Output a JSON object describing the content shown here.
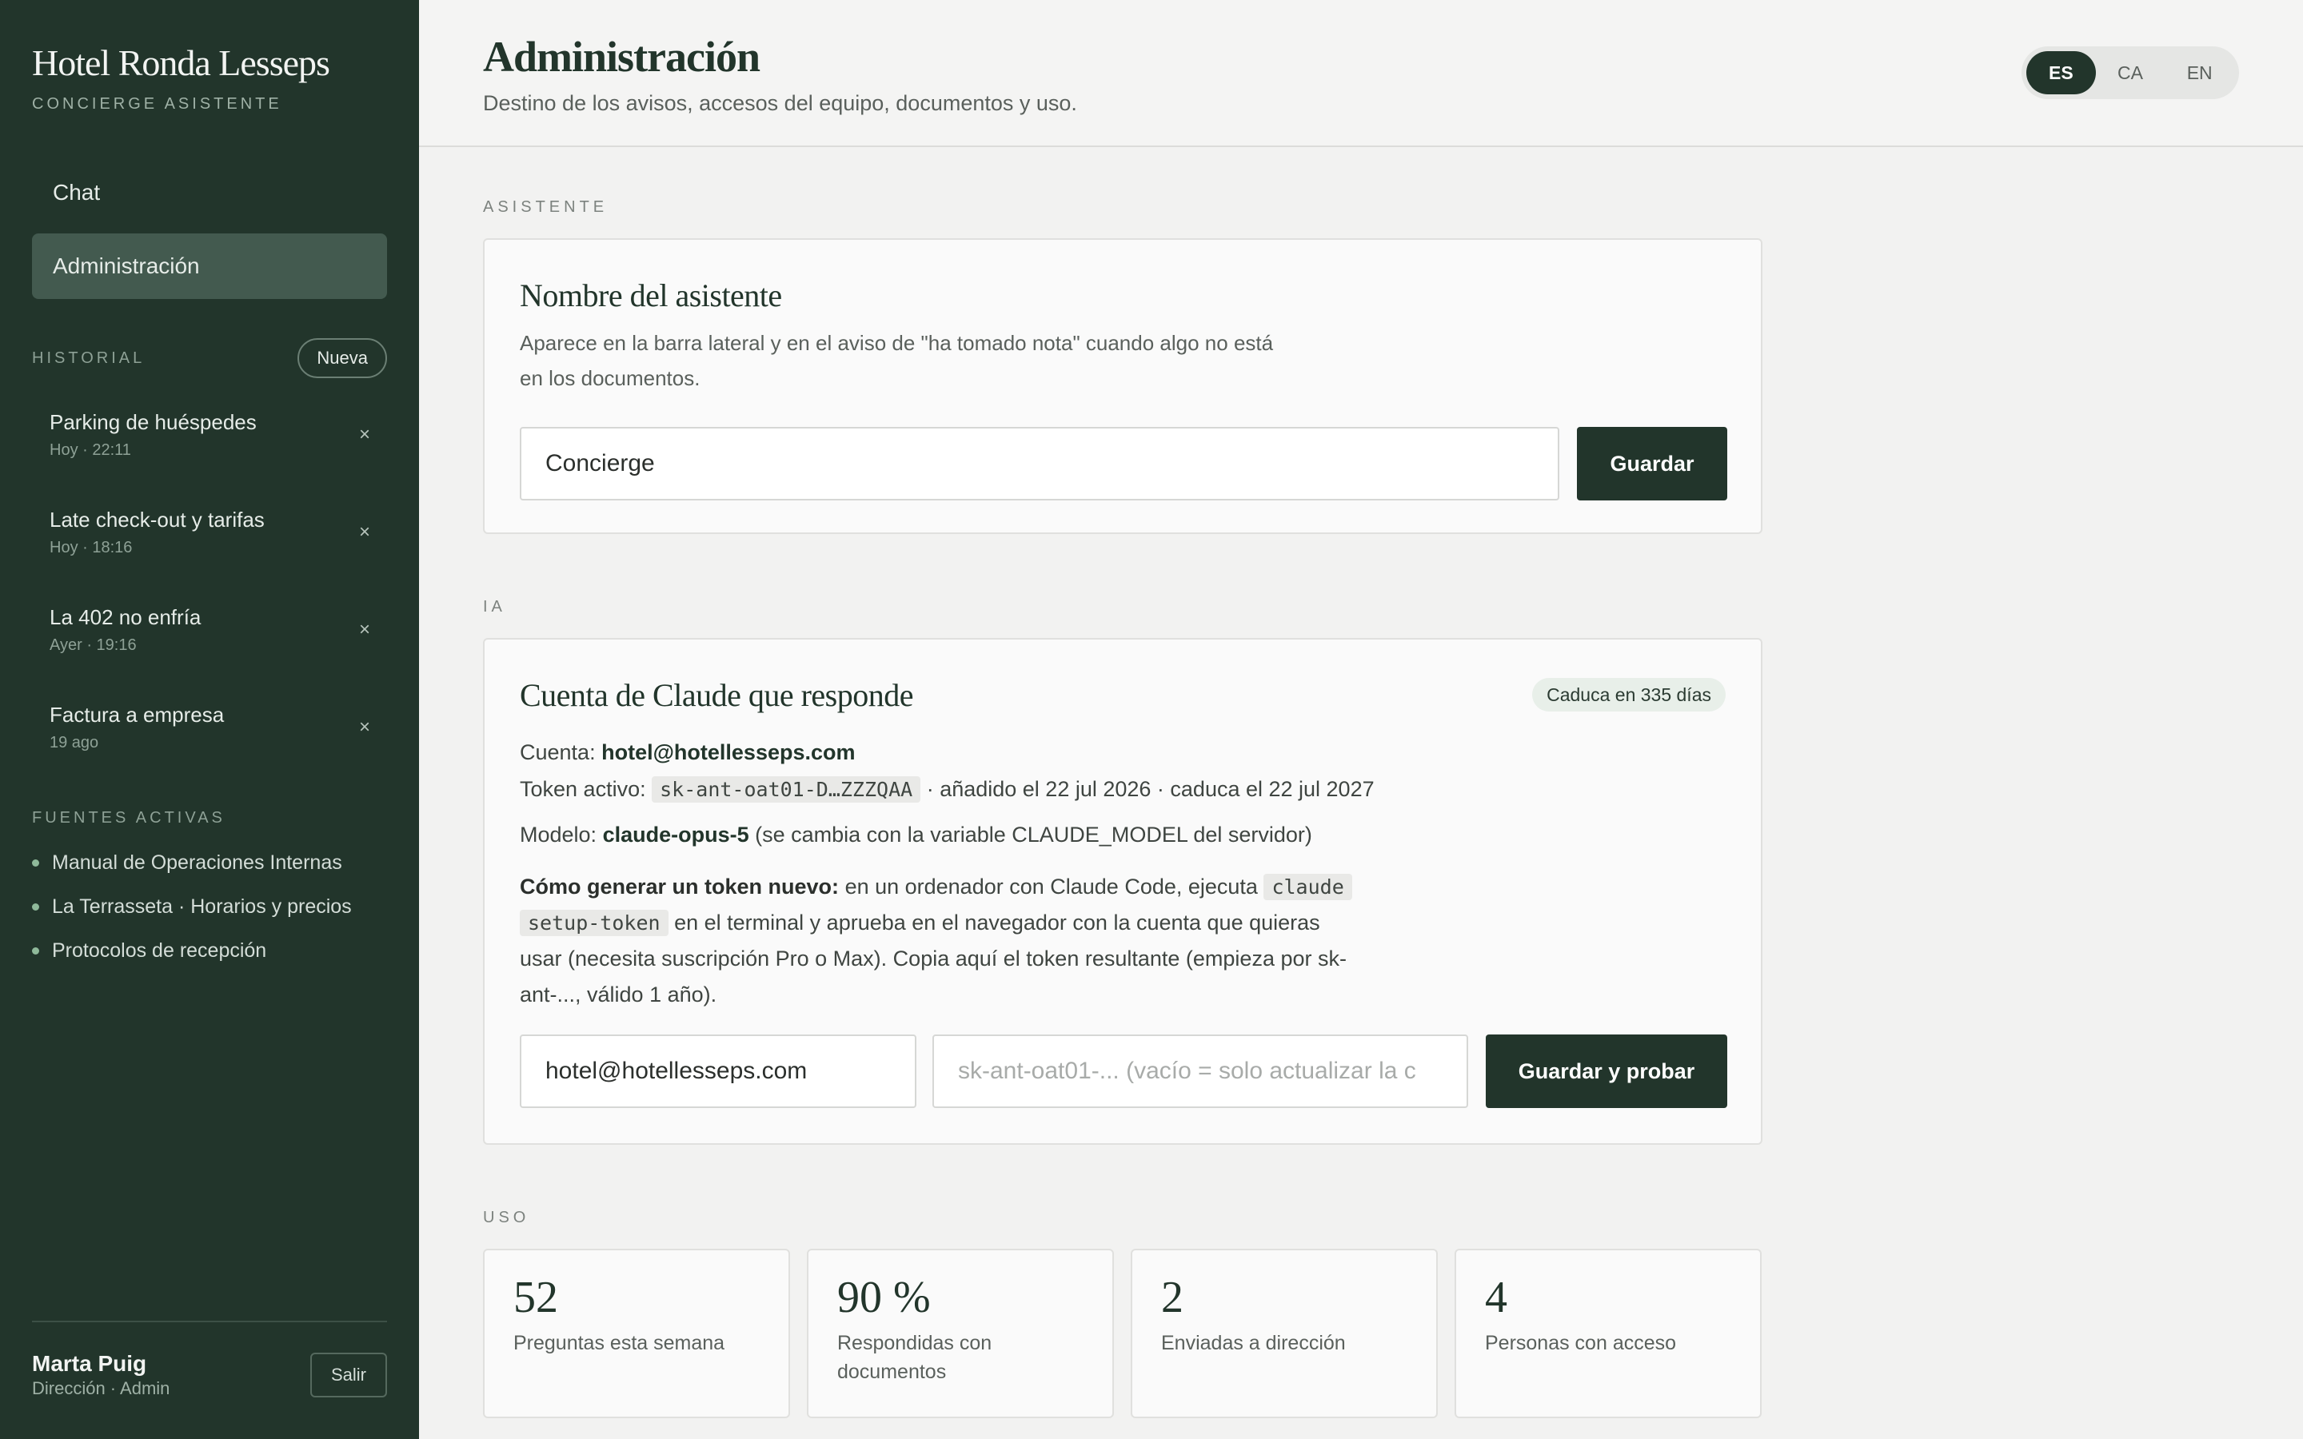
{
  "sidebar": {
    "brand_title": "Hotel Ronda Lesseps",
    "brand_subtitle": "CONCIERGE ASISTENTE",
    "nav": [
      {
        "label": "Chat",
        "active": false
      },
      {
        "label": "Administración",
        "active": true
      }
    ],
    "history_label": "HISTORIAL",
    "new_button": "Nueva",
    "history": [
      {
        "title": "Parking de huéspedes",
        "time": "Hoy · 22:11"
      },
      {
        "title": "Late check-out y tarifas",
        "time": "Hoy · 18:16"
      },
      {
        "title": "La 402 no enfría",
        "time": "Ayer · 19:16"
      },
      {
        "title": "Factura a empresa",
        "time": "19 ago"
      }
    ],
    "close_glyph": "×",
    "sources_label": "FUENTES ACTIVAS",
    "sources": [
      "Manual de Operaciones Internas",
      "La Terrasseta · Horarios y precios",
      "Protocolos de recepción"
    ],
    "user": {
      "name": "Marta Puig",
      "role": "Dirección · Admin",
      "logout": "Salir"
    }
  },
  "header": {
    "title": "Administración",
    "subtitle": "Destino de los avisos, accesos del equipo, documentos y uso.",
    "languages": [
      {
        "code": "ES",
        "active": true
      },
      {
        "code": "CA",
        "active": false
      },
      {
        "code": "EN",
        "active": false
      }
    ]
  },
  "assistant": {
    "section_label": "ASISTENTE",
    "title": "Nombre del asistente",
    "desc_line1": "Aparece en la barra lateral y en el aviso de \"ha tomado nota\" cuando algo no está",
    "desc_line2": "en los documentos.",
    "name_value": "Concierge",
    "save": "Guardar"
  },
  "ai": {
    "section_label": "IA",
    "title": "Cuenta de Claude que responde",
    "badge": "Caduca en 335 días",
    "account_label": "Cuenta:",
    "account_value": "hotel@hotellesseps.com",
    "token_label": "Token activo:",
    "token_value": "sk-ant-oat01-D…ZZZQAA",
    "token_meta": "· añadido el 22 jul 2026 · caduca el 22 jul 2027",
    "model_label": "Modelo:",
    "model_value": "claude-opus-5",
    "model_note": "(se cambia con la variable CLAUDE_MODEL del servidor)",
    "help_bold": "Cómo generar un token nuevo:",
    "help_pre": "en un ordenador con Claude Code, ejecuta",
    "help_code_1": "claude",
    "help_code_2": "setup-token",
    "help_mid": "en el terminal y aprueba en el navegador con la cuenta que quieras",
    "help_line3": "usar (necesita suscripción Pro o Max). Copia aquí el token resultante (empieza por sk-",
    "help_line4": "ant-..., válido 1 año).",
    "email_value": "hotel@hotellesseps.com",
    "token_placeholder": "sk-ant-oat01-... (vacío = solo actualizar la c",
    "save_test": "Guardar y probar"
  },
  "usage": {
    "section_label": "USO",
    "stats": [
      {
        "value": "52",
        "label": "Preguntas esta semana"
      },
      {
        "value": "90 %",
        "label": "Respondidas con documentos"
      },
      {
        "value": "2",
        "label": "Enviadas a dirección"
      },
      {
        "value": "4",
        "label": "Personas con acceso"
      }
    ]
  },
  "colors": {
    "sidebar_bg": "#22352b",
    "accent": "#22352b",
    "page_bg": "#f2f2f1"
  }
}
